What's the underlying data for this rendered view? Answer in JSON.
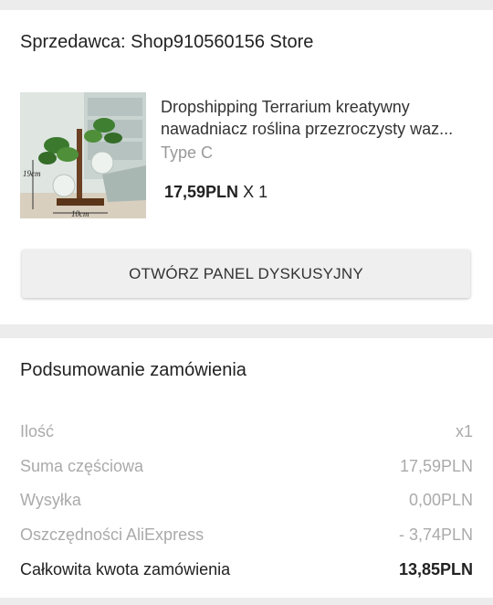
{
  "seller": {
    "label": "Sprzedawca: Shop910560156 Store"
  },
  "product": {
    "title_line1": "Dropshipping Terrarium kreatywny",
    "title_line2": "nawadniacz roślina przezroczysty waz...",
    "variant": "Type C",
    "price": "17,59PLN",
    "quantity": "X 1",
    "image_labels": {
      "height": "19cm",
      "width": "10cm"
    }
  },
  "dispute_button": {
    "label": "OTWÓRZ PANEL DYSKUSYJNY"
  },
  "summary": {
    "title": "Podsumowanie zamówienia",
    "rows": [
      {
        "label": "Ilość",
        "value": "x1"
      },
      {
        "label": "Suma częściowa",
        "value": "17,59PLN"
      },
      {
        "label": "Wysyłka",
        "value": "0,00PLN"
      },
      {
        "label": "Oszczędności AliExpress",
        "value": "-  3,74PLN"
      }
    ],
    "total": {
      "label": "Całkowita kwota zamówienia",
      "value": "13,85PLN"
    }
  }
}
